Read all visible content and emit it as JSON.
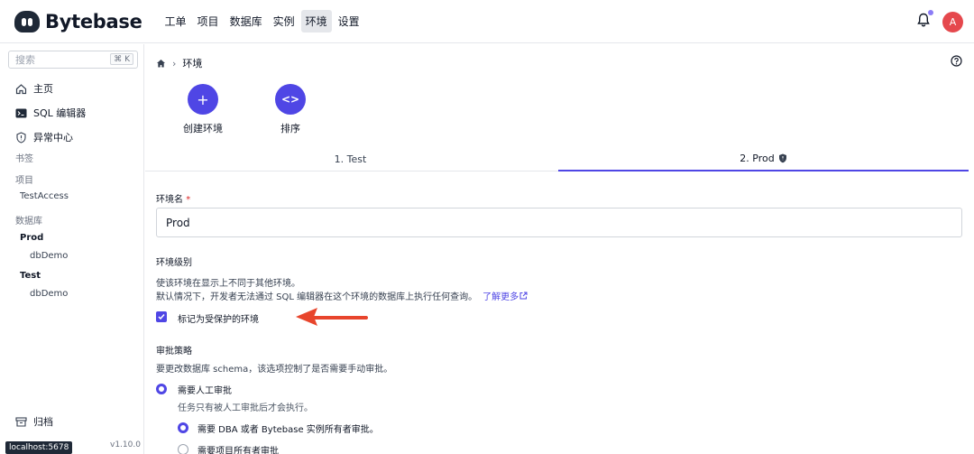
{
  "header": {
    "brand": "Bytebase",
    "nav": [
      "工单",
      "项目",
      "数据库",
      "实例",
      "环境",
      "设置"
    ],
    "active_nav": "环境",
    "avatar_initial": "A"
  },
  "sidebar": {
    "search_placeholder": "搜索",
    "search_shortcut": "⌘ K",
    "items": [
      {
        "label": "主页",
        "icon": "home-icon"
      },
      {
        "label": "SQL 编辑器",
        "icon": "terminal-icon"
      },
      {
        "label": "异常中心",
        "icon": "shield-alert-icon"
      }
    ],
    "bookmarks_label": "书签",
    "projects_label": "项目",
    "project_items": [
      "TestAccess"
    ],
    "databases_label": "数据库",
    "db_groups": [
      {
        "env": "Prod",
        "dbs": [
          "dbDemo"
        ]
      },
      {
        "env": "Test",
        "dbs": [
          "dbDemo"
        ]
      }
    ],
    "archive_label": "归档",
    "tooltip": "localhost:5678",
    "version": "v1.10.0"
  },
  "main": {
    "breadcrumb": "环境",
    "actions": [
      {
        "label": "创建环境",
        "icon": "plus-icon"
      },
      {
        "label": "排序",
        "icon": "code-icon"
      }
    ],
    "tabs": [
      "1. Test",
      "2. Prod"
    ],
    "active_tab": "2. Prod",
    "env_name_label": "环境名",
    "env_name_required": "*",
    "env_name_value": "Prod",
    "tier_label": "环境级别",
    "tier_desc_1": "使该环境在显示上不同于其他环境。",
    "tier_desc_2": "默认情况下，开发者无法通过 SQL 编辑器在这个环境的数据库上执行任何查询。",
    "learn_more": "了解更多",
    "protected_label": "标记为受保护的环境",
    "protected_checked": true,
    "approval_label": "审批策略",
    "approval_desc": "要更改数据库 schema，该选项控制了是否需要手动审批。",
    "manual_label": "需要人工审批",
    "manual_sub": "任务只有被人工审批后才会执行。",
    "opt_dba": "需要 DBA 或者 Bytebase 实例所有者审批。",
    "opt_project": "需要项目所有者审批"
  },
  "colors": {
    "accent": "#4f46e5",
    "arrow": "#e8452c",
    "avatar": "#e5484d"
  }
}
